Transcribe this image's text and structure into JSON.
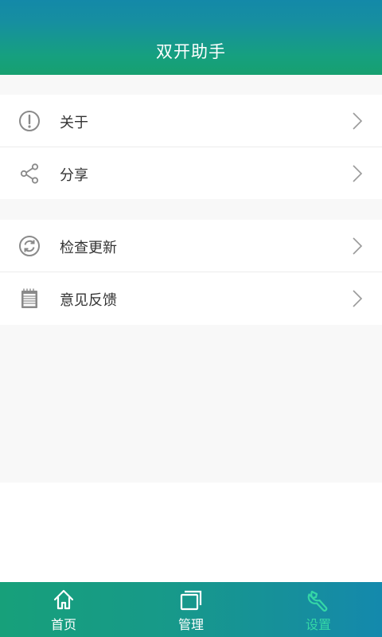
{
  "header": {
    "title": "双开助手"
  },
  "menu_groups": [
    {
      "items": [
        {
          "label": "关于",
          "icon": "info-circle-icon"
        },
        {
          "label": "分享",
          "icon": "share-icon"
        }
      ]
    },
    {
      "items": [
        {
          "label": "检查更新",
          "icon": "refresh-icon"
        },
        {
          "label": "意见反馈",
          "icon": "notepad-icon"
        }
      ]
    }
  ],
  "tabbar": {
    "tabs": [
      {
        "label": "首页",
        "icon": "home-icon"
      },
      {
        "label": "管理",
        "icon": "windows-icon"
      },
      {
        "label": "设置",
        "icon": "wrench-icon",
        "active": true
      }
    ]
  },
  "colors": {
    "header_gradient_top": "#1489a8",
    "header_gradient_bottom": "#17a070",
    "active_tab": "#35d7a6",
    "icon_gray": "#8a8a8a",
    "background": "#f8f8f8"
  }
}
